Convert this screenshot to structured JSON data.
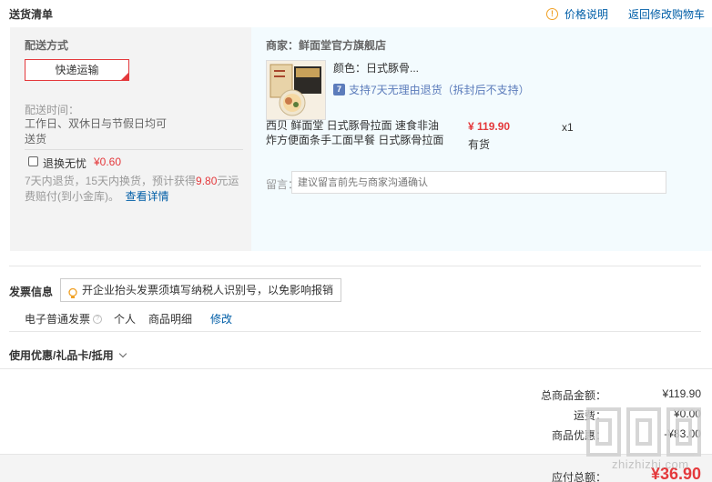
{
  "header": {
    "title": "送货清单",
    "price_note": "价格说明",
    "back_to_cart": "返回修改购物车"
  },
  "shipping": {
    "label": "配送方式",
    "method": "快递运输",
    "time_label": "配送时间：",
    "time_value": "工作日、双休日与节假日均可送货",
    "return_label": "退换无忧",
    "return_price": "¥0.60",
    "return_desc_prefix": "7天内退货，15天内换货，预计获得",
    "return_desc_amount": "9.80",
    "return_desc_suffix": "元运费赔付(到小金库)。",
    "details_link": "查看详情"
  },
  "shop": {
    "merchant": "商家：鲜面堂官方旗舰店",
    "color": "颜色：日式豚骨...",
    "support": "支持7天无理由退货（拆封后不支持）",
    "product_name": "西贝 鲜面堂 日式豚骨拉面 速食非油炸方便面条手工面早餐 日式豚骨拉面",
    "price": "¥ 119.90",
    "stock": "有货",
    "qty": "x1",
    "remark_label": "留言：",
    "remark_placeholder": "建议留言前先与商家沟通确认"
  },
  "invoice": {
    "title": "发票信息",
    "tip": "开企业抬头发票须填写纳税人识别号，以免影响报销",
    "type": "电子普通发票",
    "head": "个人",
    "content": "商品明细",
    "modify": "修改"
  },
  "coupon": {
    "title": "使用优惠/礼品卡/抵用"
  },
  "summary": {
    "total_label": "总商品金额：",
    "total_value": "¥119.90",
    "ship_label": "运费：",
    "ship_value": "¥0.00",
    "discount_label": "商品优惠：",
    "discount_value": "-¥83.00",
    "pay_label": "应付总额：",
    "pay_value": "¥36.90"
  },
  "watermark": {
    "text": "zhizhizhi.com"
  },
  "colors": {
    "accent_red": "#e4393c",
    "link_blue": "#005ea7",
    "panel_gray": "#f3f3f3",
    "panel_blue": "#f3fbfe"
  }
}
